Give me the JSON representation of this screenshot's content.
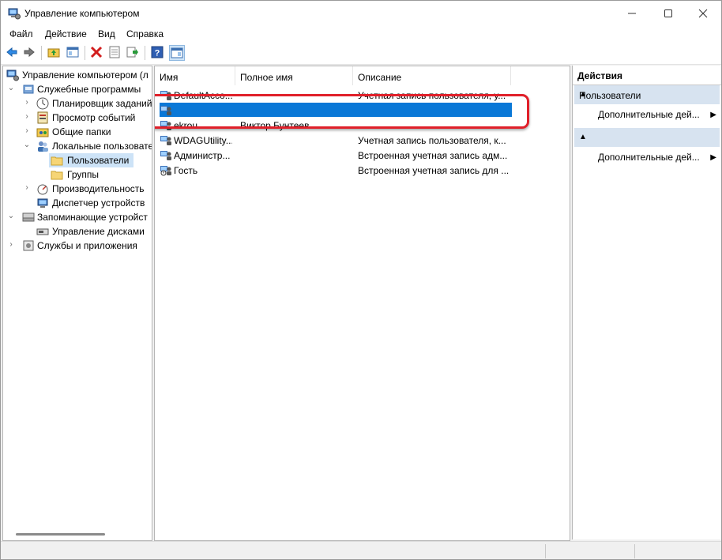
{
  "window": {
    "title": "Управление компьютером"
  },
  "menu": [
    "Файл",
    "Действие",
    "Вид",
    "Справка"
  ],
  "toolbar_icons": [
    "back-arrow-icon",
    "forward-arrow-icon",
    "up-folder-icon",
    "show-tree-icon",
    "delete-icon",
    "properties-icon",
    "export-icon",
    "help-icon",
    "show-action-pane-icon"
  ],
  "tree": [
    {
      "label": "Управление компьютером (л",
      "icon": "computer-icon",
      "chev": ""
    },
    {
      "label": "Служебные программы",
      "icon": "tools-icon",
      "chev": "v"
    },
    {
      "label": "Планировщик заданий",
      "icon": "clock-icon",
      "chev": ">"
    },
    {
      "label": "Просмотр событий",
      "icon": "event-viewer-icon",
      "chev": ">"
    },
    {
      "label": "Общие папки",
      "icon": "shared-folder-icon",
      "chev": ">"
    },
    {
      "label": "Локальные пользовате",
      "icon": "users-icon",
      "chev": "v"
    },
    {
      "label": "Пользователи",
      "icon": "folder-icon",
      "chev": ""
    },
    {
      "label": "Группы",
      "icon": "folder-icon",
      "chev": ""
    },
    {
      "label": "Производительность",
      "icon": "performance-icon",
      "chev": ">"
    },
    {
      "label": "Диспетчер устройств",
      "icon": "device-manager-icon",
      "chev": ""
    },
    {
      "label": "Запоминающие устройст",
      "icon": "storage-icon",
      "chev": "v"
    },
    {
      "label": "Управление дисками",
      "icon": "disk-icon",
      "chev": ""
    },
    {
      "label": "Службы и приложения",
      "icon": "services-icon",
      "chev": ">"
    }
  ],
  "columns": [
    "Имя",
    "Полное имя",
    "Описание"
  ],
  "rows": [
    {
      "name": "DefaultAcco...",
      "fullname": "",
      "desc": "Учетная запись пользователя, у..."
    },
    {
      "name": "",
      "fullname": "",
      "desc": ""
    },
    {
      "name": "ekrou",
      "fullname": "Виктор Бунтеев",
      "desc": ""
    },
    {
      "name": "WDAGUtility...",
      "fullname": "",
      "desc": "Учетная запись пользователя, к..."
    },
    {
      "name": "Администр...",
      "fullname": "",
      "desc": "Встроенная учетная запись адм..."
    },
    {
      "name": "Гость",
      "fullname": "",
      "desc": "Встроенная учетная запись для ..."
    }
  ],
  "actions": {
    "title": "Действия",
    "group1": "Пользователи",
    "group1_item": "Дополнительные дей...",
    "group2": "",
    "group2_item": "Дополнительные дей..."
  },
  "colors": {
    "selection": "#0a78d7",
    "highlight": "#e0202a",
    "action_group": "#d7e3f0"
  }
}
